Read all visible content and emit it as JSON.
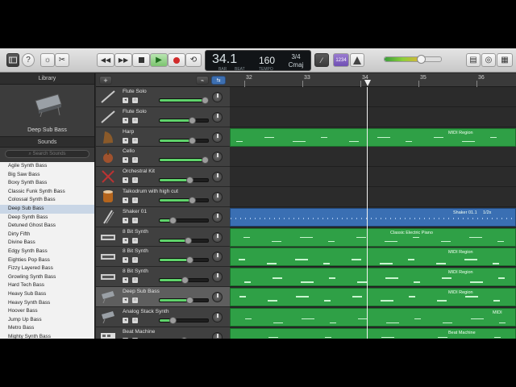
{
  "toolbar": {
    "lcd_bar": "34.1",
    "lcd_bar_caption": "BAR",
    "lcd_beat_caption": "BEAT",
    "tempo": "160",
    "tempo_caption": "TEMPO",
    "time_signature": "3/4",
    "key": "Cmaj",
    "count_in": "1234",
    "master_volume_fraction": 0.63
  },
  "library": {
    "title": "Library",
    "selected_patch": "Deep Sub Bass",
    "sounds_header": "Sounds",
    "search_placeholder": "Search Sounds",
    "items": [
      "Agile Synth Bass",
      "Big Saw Bass",
      "Boxy Synth Bass",
      "Classic Funk Synth Bass",
      "Colossal Synth Bass",
      "Deep Sub Bass",
      "Deep Synth Bass",
      "Detuned Ghost Bass",
      "Dirty Fifth",
      "Divine Bass",
      "Edgy Synth Bass",
      "Eighties Pop Bass",
      "Fizzy Layered Bass",
      "Growling Synth Bass",
      "Hard Tech Bass",
      "Heavy Sub Bass",
      "Heavy Synth Bass",
      "Hoover Bass",
      "Jump Up Bass",
      "Metro Bass",
      "Mighty Synth Bass"
    ],
    "selected_index": 5
  },
  "ruler": {
    "bars": [
      "32",
      "33",
      "34",
      "35",
      "36"
    ]
  },
  "tracks": [
    {
      "name": "Flute Solo",
      "volume": 0.92,
      "region": "",
      "region_color": "none"
    },
    {
      "name": "Flute Solo",
      "volume": 0.66,
      "region": "",
      "region_color": "none"
    },
    {
      "name": "Harp",
      "volume": 0.66,
      "region": "MIDI Region",
      "region_color": "green"
    },
    {
      "name": "Cello",
      "volume": 0.92,
      "region": "",
      "region_color": "none"
    },
    {
      "name": "Orchestral Kit",
      "volume": 0.62,
      "region": "",
      "region_color": "none"
    },
    {
      "name": "Taikodrum with high cut",
      "volume": 0.66,
      "region": "",
      "region_color": "none"
    },
    {
      "name": "Shaker 01",
      "volume": 0.28,
      "region": "Shaker 01.1",
      "region_extra": "1/2x",
      "region_color": "blue"
    },
    {
      "name": "8 Bit Synth",
      "volume": 0.58,
      "region": "Classic Electric Piano",
      "region_color": "green"
    },
    {
      "name": "8 Bit Synth",
      "volume": 0.62,
      "region": "MIDI Region",
      "region_color": "green"
    },
    {
      "name": "8 Bit Synth",
      "volume": 0.52,
      "region": "MIDI Region",
      "region_color": "green"
    },
    {
      "name": "Deep Sub Bass",
      "volume": 0.62,
      "region": "MIDI Region",
      "region_color": "green"
    },
    {
      "name": "Analog Stack Synth",
      "volume": 0.28,
      "region": "MIDI",
      "region_color": "green"
    },
    {
      "name": "Beat Machine",
      "volume": 0.5,
      "region": "Beat Machine",
      "region_color": "green"
    }
  ],
  "selected_track_index": 10,
  "playhead_bar": 34.1,
  "colors": {
    "region_green": "#2fa046",
    "region_blue": "#3a6fb3",
    "fader_green": "#5fd36b"
  }
}
